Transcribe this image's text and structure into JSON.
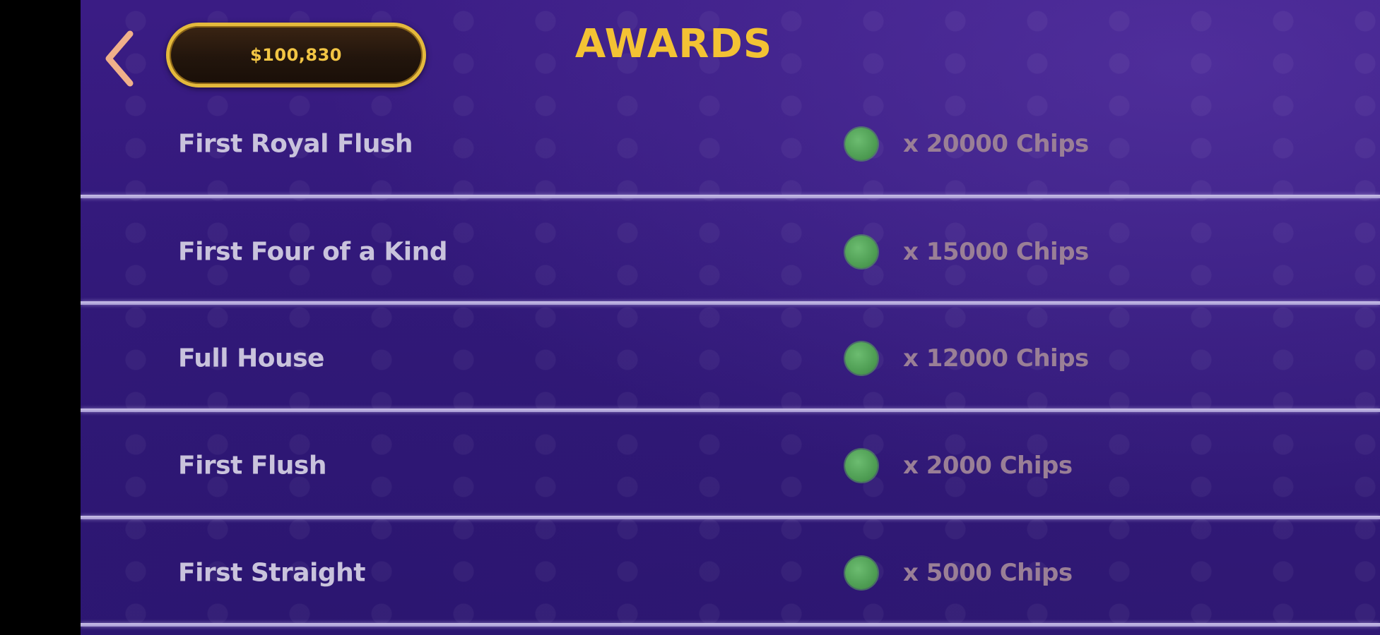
{
  "header": {
    "balance": "$100,830",
    "title": "AWARDS"
  },
  "colors": {
    "title": "#f3c234",
    "pill_border": "#e4b93c",
    "chip": "#4f9e54",
    "label": "#c9c3dc",
    "reward": "#9a7f96",
    "back_arrow": "#f0b08a"
  },
  "icons": {
    "back": "chevron-left-icon",
    "chip": "chip-icon"
  },
  "awards": [
    {
      "label": "First Royal Flush",
      "reward": "x 20000 Chips"
    },
    {
      "label": "First Four of a Kind",
      "reward": "x 15000 Chips"
    },
    {
      "label": "Full House",
      "reward": "x 12000 Chips"
    },
    {
      "label": "First Flush",
      "reward": "x 2000 Chips"
    },
    {
      "label": "First Straight",
      "reward": "x 5000 Chips"
    }
  ]
}
